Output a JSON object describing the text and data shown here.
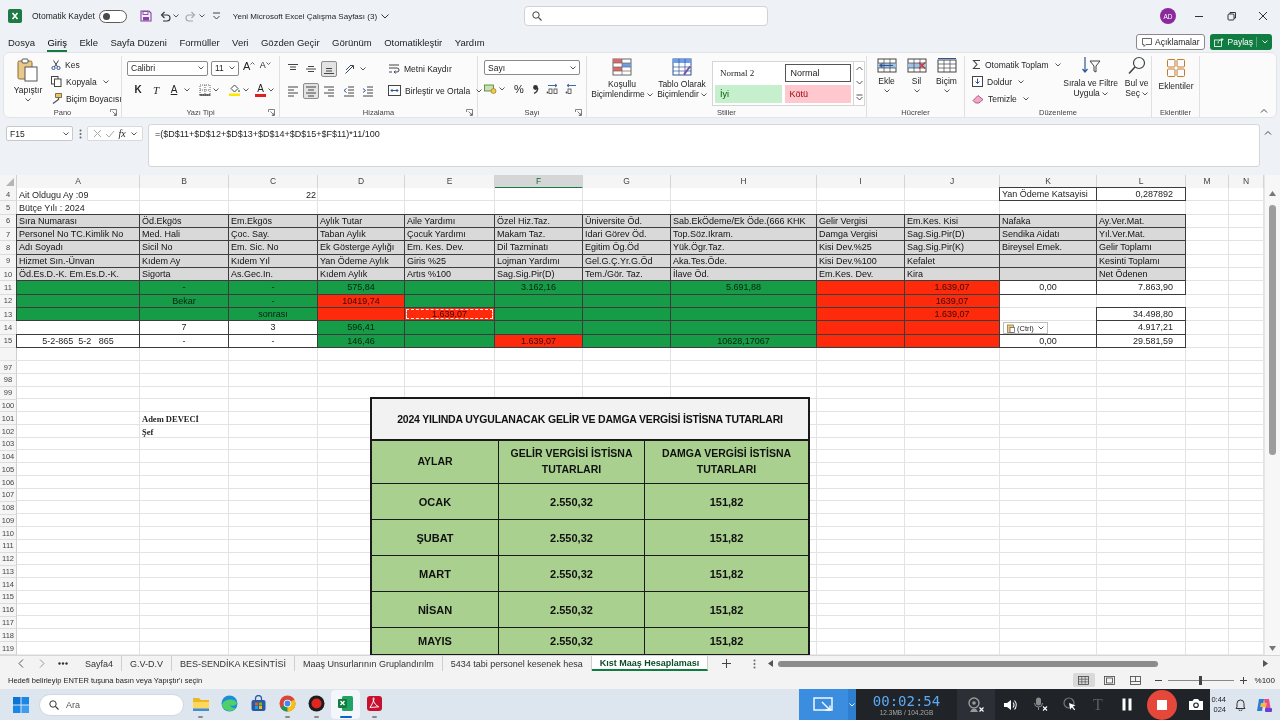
{
  "titlebar": {
    "autosave_label": "Otomatik Kaydet",
    "autosave_on": false,
    "undo_disabled": false,
    "redo_disabled": true,
    "title": "Yeni Microsoft Excel Çalışma Sayfası (3)",
    "avatar": "AD"
  },
  "menu": {
    "tabs": [
      {
        "label": "Dosya",
        "selected": false
      },
      {
        "label": "Giriş",
        "selected": true
      },
      {
        "label": "Ekle",
        "selected": false
      },
      {
        "label": "Sayfa Düzeni",
        "selected": false
      },
      {
        "label": "Formüller",
        "selected": false
      },
      {
        "label": "Veri",
        "selected": false
      },
      {
        "label": "Gözden Geçir",
        "selected": false
      },
      {
        "label": "Görünüm",
        "selected": false
      },
      {
        "label": "Otomatikleştir",
        "selected": false
      },
      {
        "label": "Yardım",
        "selected": false
      }
    ],
    "comments": "Açıklamalar",
    "share": "Paylaş"
  },
  "ribbon": {
    "clipboard": {
      "paste": "Yapıştır",
      "cut": "Kes",
      "copy": "Kopyala",
      "format_painter": "Biçim Boyacısı",
      "label": "Pano"
    },
    "font": {
      "name": "Calibri",
      "size": "11",
      "grow": "A",
      "shrink": "A",
      "bold": "K",
      "italic": "T",
      "underline": "A",
      "font_color": "A",
      "label": "Yazı Tipi"
    },
    "alignment": {
      "vertical": [
        {
          "selected": false
        },
        {
          "selected": false
        },
        {
          "selected": true
        }
      ],
      "horizontal": [
        {
          "selected": false
        },
        {
          "selected": true
        },
        {
          "selected": false
        }
      ],
      "wrap": "Metni Kaydır",
      "merge": "Birleştir ve Ortala",
      "label": "Hizalama"
    },
    "number": {
      "format": "Sayı",
      "percent": "%",
      "label": "Sayı"
    },
    "styles": {
      "conditional": "Koşullu Biçimlendirme",
      "table": "Tablo Olarak Biçimlendir",
      "gallery": [
        {
          "label": "Normal 2",
          "kind": "serif",
          "selected": false
        },
        {
          "label": "Normal",
          "kind": "plain",
          "selected": true
        },
        {
          "label": "İyi",
          "kind": "good",
          "selected": false
        },
        {
          "label": "Kötü",
          "kind": "bad",
          "selected": false
        }
      ],
      "label": "Stiller"
    },
    "cells": {
      "insert": "Ekle",
      "delete": "Sil",
      "format": "Biçim",
      "label": "Hücreler"
    },
    "editing": {
      "autosum": "Otomatik Toplam",
      "fill": "Doldur",
      "clear": "Temizle",
      "sort": "Sırala ve Filtre Uygula",
      "find": "Bul ve Seç",
      "label": "Düzenleme"
    },
    "addins": {
      "button": "Eklentiler",
      "label": "Eklentiler"
    }
  },
  "formula_bar": {
    "name_box": "F15",
    "fx": "fx",
    "formula": "=($D$11+$D$12+$D$13+$D$14+$D$15+$F$11)*11/100"
  },
  "sheet": {
    "columns": [
      {
        "label": "A",
        "selected": false
      },
      {
        "label": "B",
        "selected": false
      },
      {
        "label": "C",
        "selected": false
      },
      {
        "label": "D",
        "selected": false
      },
      {
        "label": "E",
        "selected": false
      },
      {
        "label": "F",
        "selected": true
      },
      {
        "label": "G",
        "selected": false
      },
      {
        "label": "H",
        "selected": false
      },
      {
        "label": "I",
        "selected": false
      },
      {
        "label": "J",
        "selected": false
      },
      {
        "label": "K",
        "selected": false
      },
      {
        "label": "L",
        "selected": false
      },
      {
        "label": "M",
        "selected": false
      },
      {
        "label": "N",
        "selected": false
      }
    ],
    "frozen_rows": [
      {
        "number": "4",
        "cells": [
          {
            "kind": "text",
            "text": "Ait Oldugu Ay :09"
          },
          {
            "kind": "blank"
          },
          {
            "kind": "number",
            "text": "22"
          },
          {
            "kind": "blank"
          },
          {
            "kind": "blank"
          },
          {
            "kind": "blank"
          },
          {
            "kind": "blank"
          },
          {
            "kind": "blank"
          },
          {
            "kind": "blank"
          },
          {
            "kind": "blank"
          },
          {
            "kind": "boxed",
            "text": "Yan Ödeme Katsayisi"
          },
          {
            "kind": "boxed-number",
            "text": "0,287892"
          }
        ]
      },
      {
        "number": "5",
        "cells": [
          {
            "kind": "text",
            "text": "Bütçe Yılı : 2024"
          }
        ]
      },
      {
        "number": "6",
        "cells": [
          {
            "kind": "header",
            "text": "Sıra Numarası"
          },
          {
            "kind": "header",
            "text": "Öd.Ekgös"
          },
          {
            "kind": "header",
            "text": "Em.Ekgös"
          },
          {
            "kind": "header",
            "text": "Aylık Tutar"
          },
          {
            "kind": "header",
            "text": "Aile Yardımı"
          },
          {
            "kind": "header",
            "text": "Özel Hiz.Taz."
          },
          {
            "kind": "header",
            "text": "Üniversite Öd."
          },
          {
            "kind": "header",
            "text": "Sab.EkÖdeme/Ek Öde.(666 KHK"
          },
          {
            "kind": "header",
            "text": "Gelir Vergisi"
          },
          {
            "kind": "header",
            "text": "Em.Kes. Kisi"
          },
          {
            "kind": "header",
            "text": "Nafaka"
          },
          {
            "kind": "header",
            "text": "Ay.Ver.Mat."
          }
        ]
      },
      {
        "number": "7",
        "cells": [
          {
            "kind": "header",
            "text": "Personel No TC.Kimlik No"
          },
          {
            "kind": "header",
            "text": "Med. Hali"
          },
          {
            "kind": "header",
            "text": "Çoc. Say."
          },
          {
            "kind": "header",
            "text": "Taban Aylık"
          },
          {
            "kind": "header",
            "text": "Çocuk Yardımı"
          },
          {
            "kind": "header",
            "text": "Makam Taz."
          },
          {
            "kind": "header",
            "text": "Idari Görev Öd."
          },
          {
            "kind": "header",
            "text": "Top.Söz.Ikram."
          },
          {
            "kind": "header",
            "text": "Damga Vergisi"
          },
          {
            "kind": "header",
            "text": "Sag.Sig.Pir(D)"
          },
          {
            "kind": "header",
            "text": "Sendika Aidatı"
          },
          {
            "kind": "header",
            "text": "Yıl.Ver.Mat."
          }
        ]
      },
      {
        "number": "8",
        "cells": [
          {
            "kind": "header",
            "text": "Adı Soyadı"
          },
          {
            "kind": "header",
            "text": "Sicil No"
          },
          {
            "kind": "header",
            "text": "Em. Sic. No"
          },
          {
            "kind": "header",
            "text": "Ek Gösterge Aylığı"
          },
          {
            "kind": "header",
            "text": "Em. Kes. Dev."
          },
          {
            "kind": "header",
            "text": "Dil Tazminatı"
          },
          {
            "kind": "header",
            "text": "Egitim Ög.Öd"
          },
          {
            "kind": "header",
            "text": "Yük.Ögr.Taz."
          },
          {
            "kind": "header",
            "text": "Kisi Dev.%25"
          },
          {
            "kind": "header",
            "text": "Sag.Sig.Pir(K)"
          },
          {
            "kind": "header",
            "text": "Bireysel Emek."
          },
          {
            "kind": "header",
            "text": "Gelir Toplamı"
          }
        ]
      },
      {
        "number": "9",
        "cells": [
          {
            "kind": "header",
            "text": "Hizmet Sın.-Ünvan"
          },
          {
            "kind": "header",
            "text": "Kıdem Ay"
          },
          {
            "kind": "header",
            "text": "Kıdem Yıl"
          },
          {
            "kind": "header",
            "text": "Yan Ödeme Aylık"
          },
          {
            "kind": "header",
            "text": "Giris %25"
          },
          {
            "kind": "header",
            "text": "Lojman Yardımı"
          },
          {
            "kind": "header",
            "text": "Gel.G.Ç.Yr.G.Öd"
          },
          {
            "kind": "header",
            "text": "Aka.Tes.Öde."
          },
          {
            "kind": "header",
            "text": "Kisi Dev.%100"
          },
          {
            "kind": "header",
            "text": "Kefalet"
          },
          {
            "kind": "header"
          },
          {
            "kind": "header",
            "text": "Kesinti Toplamı"
          }
        ]
      },
      {
        "number": "10",
        "cells": [
          {
            "kind": "header",
            "text": "Öd.Es.D.-K. Em.Es.D.-K."
          },
          {
            "kind": "header",
            "text": "Sigorta"
          },
          {
            "kind": "header",
            "text": "As.Gec.In."
          },
          {
            "kind": "header",
            "text": "Kıdem Aylık"
          },
          {
            "kind": "header",
            "text": "Artıs %100"
          },
          {
            "kind": "header",
            "text": "Sag.Sig.Pir(D)"
          },
          {
            "kind": "header",
            "text": "Tem./Gör. Taz."
          },
          {
            "kind": "header",
            "text": "İlave Öd."
          },
          {
            "kind": "header",
            "text": "Em.Kes. Dev."
          },
          {
            "kind": "header",
            "text": "Kira"
          },
          {
            "kind": "header"
          },
          {
            "kind": "header",
            "text": "Net Ödenen"
          }
        ]
      },
      {
        "number": "11",
        "cells": [
          {
            "kind": "data",
            "color": "#169b47"
          },
          {
            "kind": "data",
            "text": "-",
            "color": "#169b47"
          },
          {
            "kind": "data",
            "text": "-",
            "color": "#169b47"
          },
          {
            "kind": "data",
            "text": "575,84",
            "color": "#169b47"
          },
          {
            "kind": "data",
            "color": "#169b47"
          },
          {
            "kind": "data",
            "text": "3.162,16",
            "color": "#169b47"
          },
          {
            "kind": "data",
            "color": "#169b47"
          },
          {
            "kind": "data",
            "text": "5.691,88",
            "color": "#169b47"
          },
          {
            "kind": "data",
            "color": "#fe2a0c"
          },
          {
            "kind": "data",
            "text": "1.639,07",
            "color": "#fe2a0c"
          },
          {
            "kind": "data",
            "text": "0,00"
          },
          {
            "kind": "data-number",
            "text": "7.863,90"
          }
        ]
      },
      {
        "number": "12",
        "cells": [
          {
            "kind": "data",
            "color": "#169b47"
          },
          {
            "kind": "data",
            "text": "Bekar",
            "color": "#169b47"
          },
          {
            "kind": "data",
            "text": "-",
            "color": "#169b47"
          },
          {
            "kind": "data",
            "text": "10419,74",
            "color": "#fe2a0c"
          },
          {
            "kind": "data",
            "color": "#169b47"
          },
          {
            "kind": "data",
            "color": "#169b47"
          },
          {
            "kind": "data",
            "color": "#169b47"
          },
          {
            "kind": "data",
            "color": "#169b47"
          },
          {
            "kind": "data",
            "color": "#fe2a0c"
          },
          {
            "kind": "data",
            "text": "1639,07",
            "color": "#fe2a0c"
          },
          {
            "kind": "data"
          },
          {
            "kind": "data-number"
          }
        ]
      },
      {
        "number": "13",
        "cells": [
          {
            "kind": "data",
            "color": "#169b47"
          },
          {
            "kind": "data",
            "color": "#169b47"
          },
          {
            "kind": "data",
            "text": "sonrası",
            "color": "#169b47"
          },
          {
            "kind": "data",
            "color": "#fe2a0c"
          },
          {
            "kind": "marquee",
            "text": "1.639,07",
            "color": "#fe2a0c"
          },
          {
            "kind": "data",
            "color": "#169b47"
          },
          {
            "kind": "data",
            "color": "#169b47"
          },
          {
            "kind": "data",
            "color": "#169b47"
          },
          {
            "kind": "data",
            "color": "#fe2a0c"
          },
          {
            "kind": "data",
            "text": "1.639,07",
            "color": "#fe2a0c"
          },
          {
            "kind": "data"
          },
          {
            "kind": "data-number",
            "text": "34.498,80"
          }
        ]
      },
      {
        "number": "14",
        "cells": [
          {
            "kind": "data"
          },
          {
            "kind": "data",
            "text": "7"
          },
          {
            "kind": "data",
            "text": "3"
          },
          {
            "kind": "data",
            "text": "596,41",
            "color": "#169b47"
          },
          {
            "kind": "data",
            "color": "#169b47"
          },
          {
            "kind": "data",
            "color": "#169b47"
          },
          {
            "kind": "data",
            "color": "#169b47"
          },
          {
            "kind": "data",
            "color": "#169b47"
          },
          {
            "kind": "data",
            "color": "#fe2a0c"
          },
          {
            "kind": "data",
            "color": "#fe2a0c"
          },
          {
            "kind": "data"
          },
          {
            "kind": "data-number",
            "text": "4.917,21"
          }
        ]
      },
      {
        "number": "15",
        "cells": [
          {
            "kind": "data",
            "text": "5-2-865  5-2   865"
          },
          {
            "kind": "data",
            "text": "-"
          },
          {
            "kind": "data",
            "text": "-"
          },
          {
            "kind": "data",
            "text": "146,46",
            "color": "#169b47"
          },
          {
            "kind": "data",
            "color": "#169b47"
          },
          {
            "kind": "data",
            "text": "1.639,07",
            "color": "#fe2a0c"
          },
          {
            "kind": "data",
            "color": "#169b47"
          },
          {
            "kind": "data",
            "text": "10628,17067",
            "color": "#169b47"
          },
          {
            "kind": "data",
            "color": "#fe2a0c"
          },
          {
            "kind": "data",
            "color": "#fe2a0c"
          },
          {
            "kind": "data",
            "text": "0,00"
          },
          {
            "kind": "data-number",
            "text": "29.581,59"
          }
        ]
      }
    ],
    "rows": [
      {
        "number": "97"
      },
      {
        "number": "98"
      },
      {
        "number": "99"
      },
      {
        "number": "100"
      },
      {
        "number": "101",
        "cells": [
          {
            "kind": "blank"
          },
          {
            "kind": "bold",
            "text": "Adem DEVECİ"
          }
        ]
      },
      {
        "number": "102",
        "cells": [
          {
            "kind": "blank"
          },
          {
            "kind": "bold",
            "text": "Şef"
          }
        ]
      },
      {
        "number": "103"
      },
      {
        "number": "104"
      },
      {
        "number": "105"
      },
      {
        "number": "106"
      },
      {
        "number": "107"
      },
      {
        "number": "108"
      },
      {
        "number": "109"
      },
      {
        "number": "110"
      },
      {
        "number": "111"
      },
      {
        "number": "112"
      },
      {
        "number": "113"
      },
      {
        "number": "114"
      },
      {
        "number": "115"
      },
      {
        "number": "116"
      },
      {
        "number": "117"
      },
      {
        "number": "118"
      },
      {
        "number": "119"
      }
    ],
    "paste_options": "(Ctrl)",
    "picture": {
      "title": "2024 YILINDA UYGULANACAK GELİR VE DAMGA VERGİSİ İSTİSNA TUTARLARI",
      "headers": [
        "AYLAR",
        "GELİR VERGİSİ İSTİSNA TUTARLARI",
        "DAMGA VERGİSİ İSTİSNA TUTARLARI"
      ],
      "rows": [
        [
          "OCAK",
          "2.550,32",
          "151,82"
        ],
        [
          "ŞUBAT",
          "2.550,32",
          "151,82"
        ],
        [
          "MART",
          "2.550,32",
          "151,82"
        ],
        [
          "NİSAN",
          "2.550,32",
          "151,82"
        ],
        [
          "MAYIS",
          "2.550,32",
          "151,82"
        ]
      ]
    }
  },
  "sheet_tabs": {
    "tabs": [
      {
        "label": "Sayfa4",
        "selected": false
      },
      {
        "label": "G.V-D.V",
        "selected": false
      },
      {
        "label": "BES-SENDİKA KESİNTİSİ",
        "selected": false
      },
      {
        "label": "Maaş Unsurlarının Gruplandırılm",
        "selected": false
      },
      {
        "label": "5434 tabi personel kesenek hesa",
        "selected": false
      },
      {
        "label": "Kıst Maaş Hesaplaması",
        "selected": true
      }
    ]
  },
  "status_bar": {
    "message": "Hedefi belirleyip ENTER tuşuna basın veya Yapıştır'ı seçin",
    "views": [
      {
        "selected": true
      },
      {
        "selected": false
      },
      {
        "selected": false
      }
    ],
    "zoom": {
      "level": 0.5,
      "label": "%100"
    }
  },
  "taskbar": {
    "search_placeholder": "Ara",
    "apps": [
      {
        "kind": "folder",
        "running": true,
        "selected": false
      },
      {
        "kind": "swirl",
        "running": false,
        "selected": false
      },
      {
        "kind": "bag",
        "running": false,
        "selected": false
      },
      {
        "kind": "browser",
        "running": true,
        "selected": false
      },
      {
        "kind": "record",
        "running": true,
        "selected": false
      },
      {
        "kind": "spreadsheet",
        "running": true,
        "selected": true
      },
      {
        "kind": "document",
        "running": true,
        "selected": false
      }
    ],
    "clock": {
      "time": "0:44",
      "date": "024"
    }
  },
  "recorder": {
    "timer": "00:02:54",
    "size": "12.3MB / 104.2GB",
    "webcam_on": false,
    "mic_on": false,
    "text_tool": {
      "label": "T",
      "disabled": true
    }
  }
}
